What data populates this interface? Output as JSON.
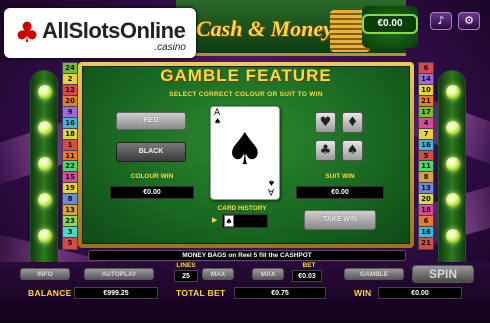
{
  "branding": {
    "site_logo_text": "AllSlotsOnline",
    "site_logo_sub": ".casino",
    "game_title": "Cash & Money",
    "jackpot_value": "€0.00"
  },
  "side_lines": {
    "left": [
      {
        "n": "24",
        "color": "#6fbf3a"
      },
      {
        "n": "2",
        "color": "#e8d23a"
      },
      {
        "n": "12",
        "color": "#d84a4a"
      },
      {
        "n": "20",
        "color": "#e87a2a"
      },
      {
        "n": "9",
        "color": "#9a6ad8"
      },
      {
        "n": "16",
        "color": "#3ab8d8"
      },
      {
        "n": "18",
        "color": "#d8d84a"
      },
      {
        "n": "1",
        "color": "#d84a4a"
      },
      {
        "n": "11",
        "color": "#e87a2a"
      },
      {
        "n": "22",
        "color": "#4ad86a"
      },
      {
        "n": "15",
        "color": "#d84aa0"
      },
      {
        "n": "19",
        "color": "#e8d23a"
      },
      {
        "n": "8",
        "color": "#6a8ad8"
      },
      {
        "n": "13",
        "color": "#d8a04a"
      },
      {
        "n": "23",
        "color": "#8ad84a"
      },
      {
        "n": "3",
        "color": "#4ad8c8"
      },
      {
        "n": "5",
        "color": "#d84a4a"
      }
    ],
    "right": [
      {
        "n": "6",
        "color": "#d84a4a"
      },
      {
        "n": "14",
        "color": "#9a6ad8"
      },
      {
        "n": "10",
        "color": "#e8d23a"
      },
      {
        "n": "21",
        "color": "#e87a2a"
      },
      {
        "n": "17",
        "color": "#6fbf3a"
      },
      {
        "n": "4",
        "color": "#d84aa0"
      },
      {
        "n": "7",
        "color": "#e8d23a"
      },
      {
        "n": "16",
        "color": "#3ab8d8"
      },
      {
        "n": "5",
        "color": "#d84a4a"
      },
      {
        "n": "11",
        "color": "#4ad86a"
      },
      {
        "n": "8",
        "color": "#d8a04a"
      },
      {
        "n": "13",
        "color": "#6a8ad8"
      },
      {
        "n": "20",
        "color": "#d8d84a"
      },
      {
        "n": "18",
        "color": "#d84aa0"
      },
      {
        "n": "6",
        "color": "#e87a2a"
      },
      {
        "n": "16",
        "color": "#3ab8d8"
      },
      {
        "n": "21",
        "color": "#d84a4a"
      }
    ]
  },
  "gamble": {
    "title": "GAMBLE FEATURE",
    "subtitle": "SELECT CORRECT COLOUR OR SUIT TO WIN",
    "red_label": "RED",
    "black_label": "BLACK",
    "colour_win_label": "COLOUR WIN",
    "colour_win_value": "€0.00",
    "suit_win_label": "SUIT WIN",
    "suit_win_value": "€0.00",
    "card_history_label": "CARD HISTORY",
    "take_win_label": "TAKE WIN",
    "card_rank": "A",
    "card_suit": "♠",
    "history_card": "♠",
    "suits": [
      "♥",
      "♦",
      "♣",
      "♠"
    ]
  },
  "message": "MONEY BAGS on Reel 5 fill the CASHPOT",
  "controls": {
    "info": "INFO",
    "autoplay": "AUTOPLAY",
    "lines_label": "LINES",
    "lines_value": "25",
    "max1": "MAX",
    "max2": "MAX",
    "bet_label": "BET",
    "bet_value": "€0.03",
    "gamble": "GAMBLE",
    "spin": "SPIN",
    "balance_label": "BALANCE",
    "balance_value": "€999.25",
    "total_bet_label": "TOTAL BET",
    "total_bet_value": "€0.75",
    "win_label": "WIN",
    "win_value": "€0.00"
  }
}
